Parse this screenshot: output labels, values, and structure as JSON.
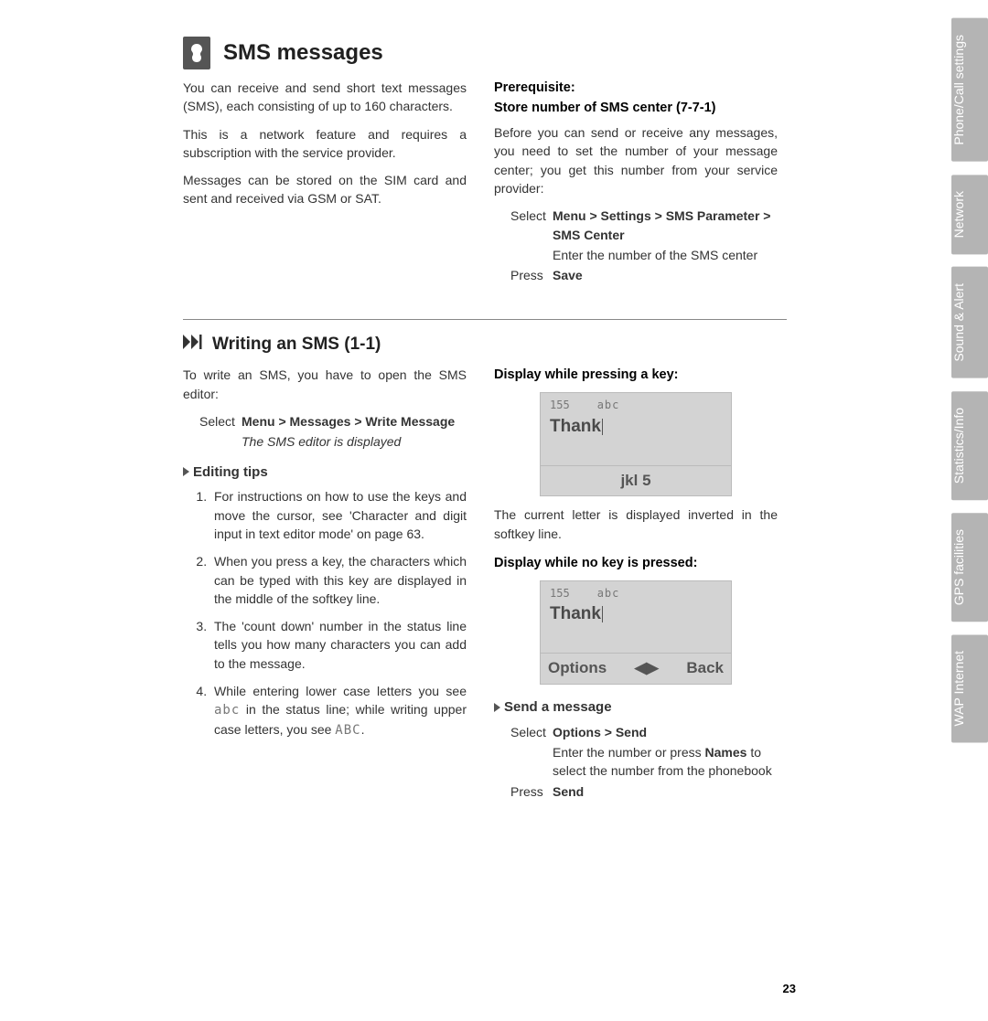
{
  "page_number": "23",
  "sidetabs": [
    "Phone/Call settings",
    "Network",
    "Sound & Alert",
    "Statistics/Info",
    "GPS facilities",
    "WAP Internet"
  ],
  "heading": "SMS messages",
  "intro": {
    "p1": "You can receive and send short text messages (SMS), each consisting of up to 160 characters.",
    "p2": "This is a network feature and requires a subscription with the service provider.",
    "p3": "Messages can be stored on the SIM card and sent and received via GSM or SAT."
  },
  "prereq": {
    "h1": "Prerequisite:",
    "h2": "Store number of SMS center (7-7-1)",
    "p1": "Before you can send or receive any messages, you need to set the number of your message center; you get this number from your service provider:",
    "step1_label": "Select",
    "step1_text": "Menu > Settings > SMS Parameter > SMS Center",
    "step2_text": "Enter the number of the SMS center",
    "step3_label": "Press",
    "step3_text": "Save"
  },
  "writing": {
    "title": "Writing an SMS (1-1)",
    "p1": "To write an SMS, you have to open the SMS editor:",
    "step1_label": "Select",
    "step1_text": "Menu > Messages > Write Message",
    "step1_result": "The SMS editor is displayed",
    "tips_heading": "Editing tips",
    "tips": [
      "For instructions on how to use the keys and move the cursor, see 'Character and digit input in text editor mode' on page 63.",
      "When you press a key, the characters which can be typed with this key are displayed in the middle of the softkey line.",
      "The 'count down' number in the status line tells you how many characters you can add to the message.",
      "While entering lower case letters you see abc in the status line; while writing upper case letters, you see ABC."
    ]
  },
  "display1": {
    "heading": "Display while pressing a key:",
    "count": "155",
    "mode": "abc",
    "text": "Thank",
    "bottom_center": "jkl 5",
    "caption": "The current letter is displayed inverted in the softkey line."
  },
  "display2": {
    "heading": "Display while no key is pressed:",
    "count": "155",
    "mode": "abc",
    "text": "Thank",
    "bottom_left": "Options",
    "bottom_mid": "◀▶",
    "bottom_right": "Back"
  },
  "send": {
    "heading": "Send a message",
    "step1_label": "Select",
    "step1_text": "Options > Send",
    "step2_a": "Enter the number or press ",
    "step2_b": "Names",
    "step2_c": " to select the number from the phonebook",
    "step3_label": "Press",
    "step3_text": "Send"
  }
}
